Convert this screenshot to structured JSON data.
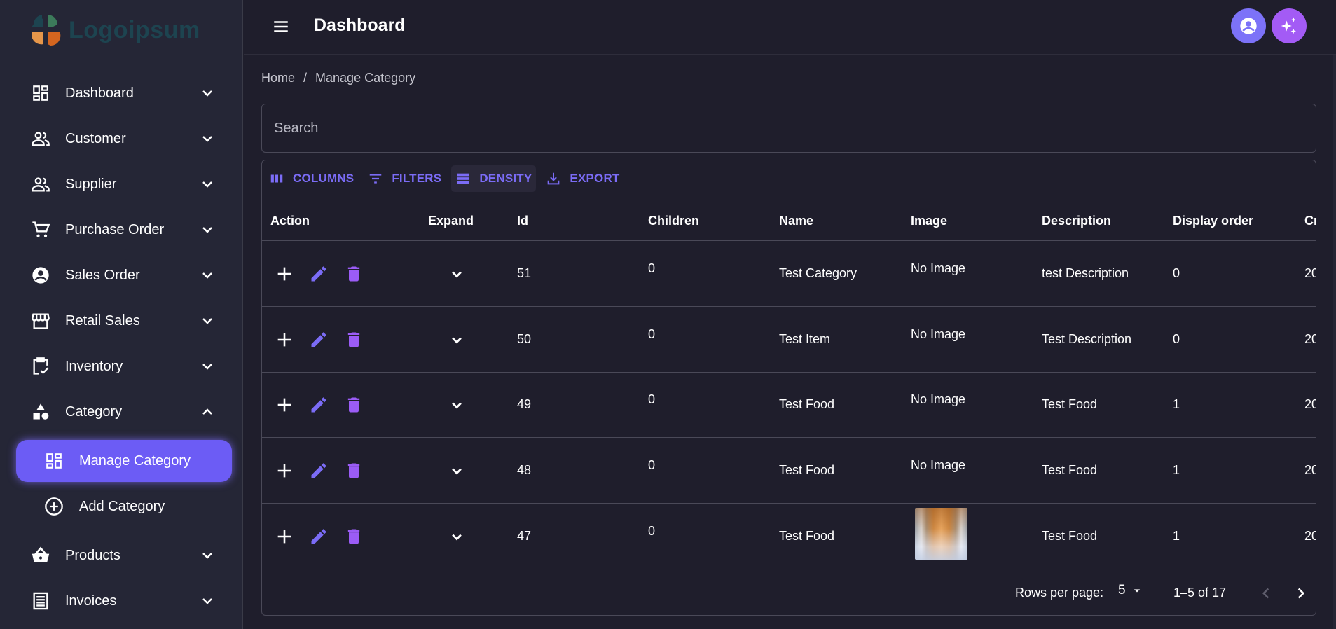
{
  "brand": {
    "name": "Logoipsum",
    "colors": {
      "teal_dark": "#1d4450",
      "green": "#3c7a5a",
      "orange_light": "#e6964a",
      "orange": "#d4651f"
    }
  },
  "theme": {
    "accent": "#6c5cf5",
    "accent_text": "#7b6cf6",
    "delete": "#9b5cf6",
    "sidebar_bg": "#252636",
    "main_bg": "#1f1e2c",
    "avatar_user": "#7c72f8",
    "avatar_ai": "#a35bf5"
  },
  "sidebar": {
    "items": [
      {
        "label": "Dashboard",
        "icon": "dashboard-icon",
        "expanded": false
      },
      {
        "label": "Customer",
        "icon": "people-icon",
        "expanded": false
      },
      {
        "label": "Supplier",
        "icon": "people-icon",
        "expanded": false
      },
      {
        "label": "Purchase Order",
        "icon": "cart-icon",
        "expanded": false
      },
      {
        "label": "Sales Order",
        "icon": "account-circle-icon",
        "expanded": false
      },
      {
        "label": "Retail Sales",
        "icon": "storefront-icon",
        "expanded": false
      },
      {
        "label": "Inventory",
        "icon": "clipboard-check-icon",
        "expanded": false
      },
      {
        "label": "Category",
        "icon": "shapes-icon",
        "expanded": true
      },
      {
        "label": "Products",
        "icon": "basket-icon",
        "expanded": false
      },
      {
        "label": "Invoices",
        "icon": "receipt-icon",
        "expanded": false
      }
    ],
    "category_children": [
      {
        "label": "Manage Category",
        "icon": "dashboard-icon",
        "active": true
      },
      {
        "label": "Add Category",
        "icon": "add-circle-icon",
        "active": false
      }
    ]
  },
  "header": {
    "title": "Dashboard",
    "user_icon": "account-circle-icon",
    "ai_icon": "sparkles-icon"
  },
  "breadcrumb": {
    "home": "Home",
    "separator": "/",
    "current": "Manage Category"
  },
  "search": {
    "placeholder": "Search",
    "value": ""
  },
  "toolbar": {
    "columns": "COLUMNS",
    "filters": "FILTERS",
    "density": "DENSITY",
    "export": "EXPORT"
  },
  "table": {
    "columns": [
      "Action",
      "Expand",
      "Id",
      "Children",
      "Name",
      "Image",
      "Description",
      "Display order",
      "Cr"
    ],
    "rows": [
      {
        "id": "51",
        "children": "0",
        "name": "Test Category",
        "image": "No Image",
        "description": "test Description",
        "display_order": "0",
        "created": "20"
      },
      {
        "id": "50",
        "children": "0",
        "name": "Test Item",
        "image": "No Image",
        "description": "Test Description",
        "display_order": "0",
        "created": "20"
      },
      {
        "id": "49",
        "children": "0",
        "name": "Test Food",
        "image": "No Image",
        "description": "Test Food",
        "display_order": "1",
        "created": "20"
      },
      {
        "id": "48",
        "children": "0",
        "name": "Test Food",
        "image": "No Image",
        "description": "Test Food",
        "display_order": "1",
        "created": "20"
      },
      {
        "id": "47",
        "children": "0",
        "name": "Test Food",
        "image": "",
        "description": "Test Food",
        "display_order": "1",
        "created": "20"
      }
    ]
  },
  "pagination": {
    "rows_per_page_label": "Rows per page:",
    "rows_per_page": "5",
    "range": "1–5 of 17"
  }
}
